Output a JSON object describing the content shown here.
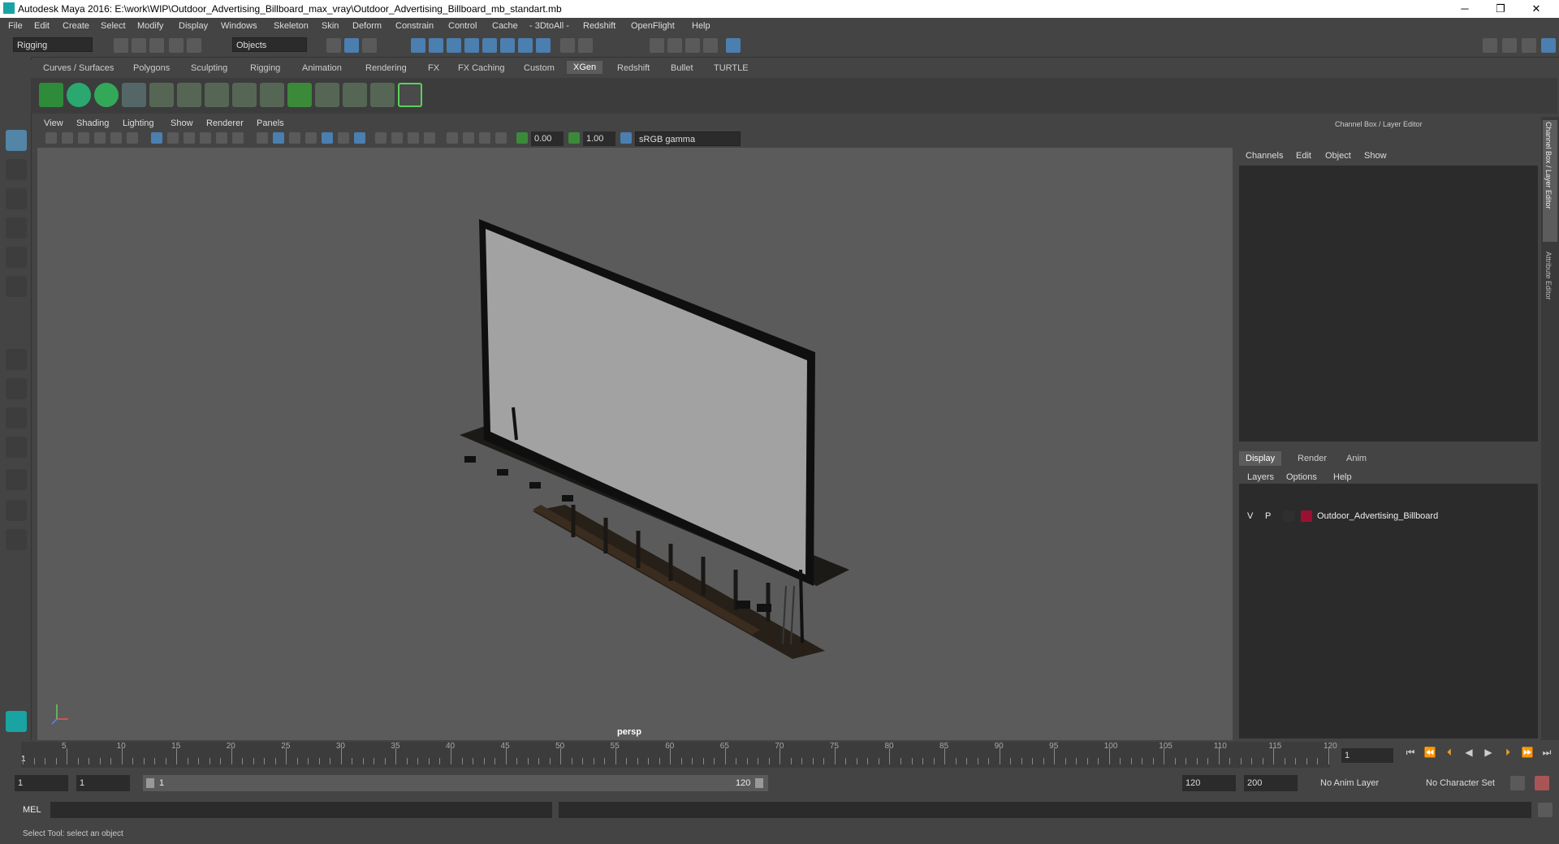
{
  "window": {
    "title": "Autodesk Maya 2016: E:\\work\\WIP\\Outdoor_Advertising_Billboard_max_vray\\Outdoor_Advertising_Billboard_mb_standart.mb",
    "min": "─",
    "restore": "❐",
    "close": "✕"
  },
  "menubar": [
    "File",
    "Edit",
    "Create",
    "Select",
    "Modify",
    "Display",
    "Windows",
    "Skeleton",
    "Skin",
    "Deform",
    "Constrain",
    "Control",
    "Cache",
    "- 3DtoAll -",
    "Redshift",
    "OpenFlight",
    "Help"
  ],
  "statusline": {
    "mode": "Rigging",
    "objects": "Objects"
  },
  "shelf_tabs": [
    "Curves / Surfaces",
    "Polygons",
    "Sculpting",
    "Rigging",
    "Animation",
    "Rendering",
    "FX",
    "FX Caching",
    "Custom",
    "XGen",
    "Redshift",
    "Bullet",
    "TURTLE"
  ],
  "active_shelf_tab": "XGen",
  "viewport": {
    "menu": [
      "View",
      "Shading",
      "Lighting",
      "Show",
      "Renderer",
      "Panels"
    ],
    "exposure": "0.00",
    "gamma": "1.00",
    "colorspace": "sRGB gamma",
    "camera": "persp"
  },
  "channel_box": {
    "title": "Channel Box / Layer Editor",
    "menu": [
      "Channels",
      "Edit",
      "Object",
      "Show"
    ]
  },
  "layer_editor": {
    "tabs": [
      "Display",
      "Render",
      "Anim"
    ],
    "active_tab": "Display",
    "menu": [
      "Layers",
      "Options",
      "Help"
    ],
    "layers": [
      {
        "v": "V",
        "p": "P",
        "name": "Outdoor_Advertising_Billboard",
        "color": "#9b1030"
      }
    ]
  },
  "side_tabs": [
    "Channel Box / Layer Editor",
    "Attribute Editor"
  ],
  "timeline": {
    "ticks": [
      "5",
      "10",
      "15",
      "20",
      "25",
      "30",
      "35",
      "40",
      "45",
      "50",
      "55",
      "60",
      "65",
      "70",
      "75",
      "80",
      "85",
      "90",
      "95",
      "100",
      "105",
      "110",
      "115",
      "120"
    ],
    "first_frame": "1",
    "current_frame": "1"
  },
  "range": {
    "start": "1",
    "playback_start": "1",
    "slider_start": "1",
    "slider_end": "120",
    "playback_end": "120",
    "end": "200",
    "anim_layer": "No Anim Layer",
    "char_set": "No Character Set"
  },
  "mel": {
    "label": "MEL"
  },
  "help_line": "Select Tool: select an object"
}
